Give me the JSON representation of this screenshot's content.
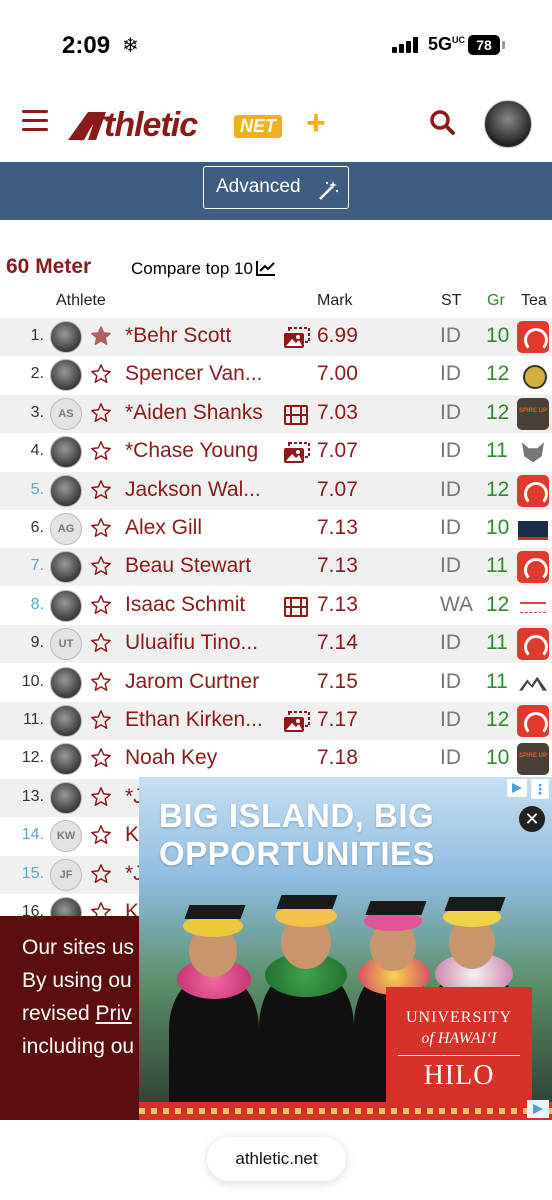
{
  "status_bar": {
    "time": "2:09",
    "network": "5G",
    "network_sup": "UC",
    "battery": "78"
  },
  "header": {
    "logo_word": "thletic",
    "logo_net": "NET",
    "logo_plus": "+"
  },
  "toolbar": {
    "advanced_label": "Advanced"
  },
  "section": {
    "title": "60 Meter",
    "compare_label": "Compare top 10"
  },
  "table": {
    "headers": {
      "athlete": "Athlete",
      "mark": "Mark",
      "state": "ST",
      "grade": "Gr",
      "team": "Tea"
    },
    "rows": [
      {
        "rank": "1.",
        "name": "*Behr Scott",
        "mark": "6.99",
        "state": "ID",
        "grade": "10",
        "initials": "",
        "starred": true,
        "media": "photo",
        "team": "red",
        "rank_blue": false
      },
      {
        "rank": "2.",
        "name": "Spencer Van...",
        "mark": "7.00",
        "state": "ID",
        "grade": "12",
        "initials": "",
        "starred": false,
        "media": "",
        "team": "gold",
        "rank_blue": false
      },
      {
        "rank": "3.",
        "name": "*Aiden Shanks",
        "mark": "7.03",
        "state": "ID",
        "grade": "12",
        "initials": "AS",
        "starred": false,
        "media": "video",
        "team": "dark",
        "rank_blue": false
      },
      {
        "rank": "4.",
        "name": "*Chase Young",
        "mark": "7.07",
        "state": "ID",
        "grade": "11",
        "initials": "",
        "starred": false,
        "media": "photo",
        "team": "wolf",
        "rank_blue": false
      },
      {
        "rank": "5.",
        "name": "Jackson Wal...",
        "mark": "7.07",
        "state": "ID",
        "grade": "12",
        "initials": "",
        "starred": false,
        "media": "",
        "team": "red",
        "rank_blue": true
      },
      {
        "rank": "6.",
        "name": "Alex Gill",
        "mark": "7.13",
        "state": "ID",
        "grade": "10",
        "initials": "AG",
        "starred": false,
        "media": "",
        "team": "navy",
        "rank_blue": false
      },
      {
        "rank": "7.",
        "name": "Beau Stewart",
        "mark": "7.13",
        "state": "ID",
        "grade": "11",
        "initials": "",
        "starred": false,
        "media": "",
        "team": "red",
        "rank_blue": true
      },
      {
        "rank": "8.",
        "name": "Isaac Schmit",
        "mark": "7.13",
        "state": "WA",
        "grade": "12",
        "initials": "",
        "starred": false,
        "media": "video",
        "team": "pink",
        "rank_blue": true
      },
      {
        "rank": "9.",
        "name": "Uluaifiu Tino...",
        "mark": "7.14",
        "state": "ID",
        "grade": "11",
        "initials": "UT",
        "starred": false,
        "media": "",
        "team": "red",
        "rank_blue": false
      },
      {
        "rank": "10.",
        "name": "Jarom Curtner",
        "mark": "7.15",
        "state": "ID",
        "grade": "11",
        "initials": "",
        "starred": false,
        "media": "",
        "team": "mtn",
        "rank_blue": false
      },
      {
        "rank": "11.",
        "name": "Ethan Kirken...",
        "mark": "7.17",
        "state": "ID",
        "grade": "12",
        "initials": "",
        "starred": false,
        "media": "photo",
        "team": "red",
        "rank_blue": false
      },
      {
        "rank": "12.",
        "name": "Noah Key",
        "mark": "7.18",
        "state": "ID",
        "grade": "10",
        "initials": "",
        "starred": false,
        "media": "",
        "team": "dark",
        "rank_blue": false
      },
      {
        "rank": "13.",
        "name": "*J",
        "mark": "",
        "state": "",
        "grade": "",
        "initials": "",
        "starred": false,
        "media": "",
        "team": "",
        "rank_blue": false
      },
      {
        "rank": "14.",
        "name": "K",
        "mark": "",
        "state": "",
        "grade": "",
        "initials": "KW",
        "starred": false,
        "media": "",
        "team": "",
        "rank_blue": true
      },
      {
        "rank": "15.",
        "name": "*J",
        "mark": "",
        "state": "",
        "grade": "",
        "initials": "JF",
        "starred": false,
        "media": "",
        "team": "",
        "rank_blue": true
      },
      {
        "rank": "16.",
        "name": "K",
        "mark": "",
        "state": "",
        "grade": "",
        "initials": "",
        "starred": false,
        "media": "",
        "team": "",
        "rank_blue": false
      }
    ]
  },
  "cookie_banner": {
    "line1": "Our sites us",
    "line2": "By using ou",
    "line3_prefix": "revised ",
    "line3_link": "Priv",
    "line4": "including ou"
  },
  "ad": {
    "headline": "BIG ISLAND, BIG OPPORTUNITIES",
    "close": "✕",
    "logo_line1": "UNIVERSITY",
    "logo_line2": "of HAWAIʻI",
    "logo_line3": "HILO"
  },
  "browser": {
    "url": "athletic.net"
  },
  "colors": {
    "brand": "#8b1a1a",
    "accent": "#f2b01e",
    "toolbar": "#3e5d80",
    "grade": "#2e8b2e",
    "cookie_bg": "#5c0e0e"
  },
  "icons": {
    "menu": "hamburger-icon",
    "search": "search-icon",
    "wand": "magic-wand-icon",
    "chart": "chart-icon",
    "star": "star-icon",
    "photo": "photo-icon",
    "video": "video-icon"
  }
}
